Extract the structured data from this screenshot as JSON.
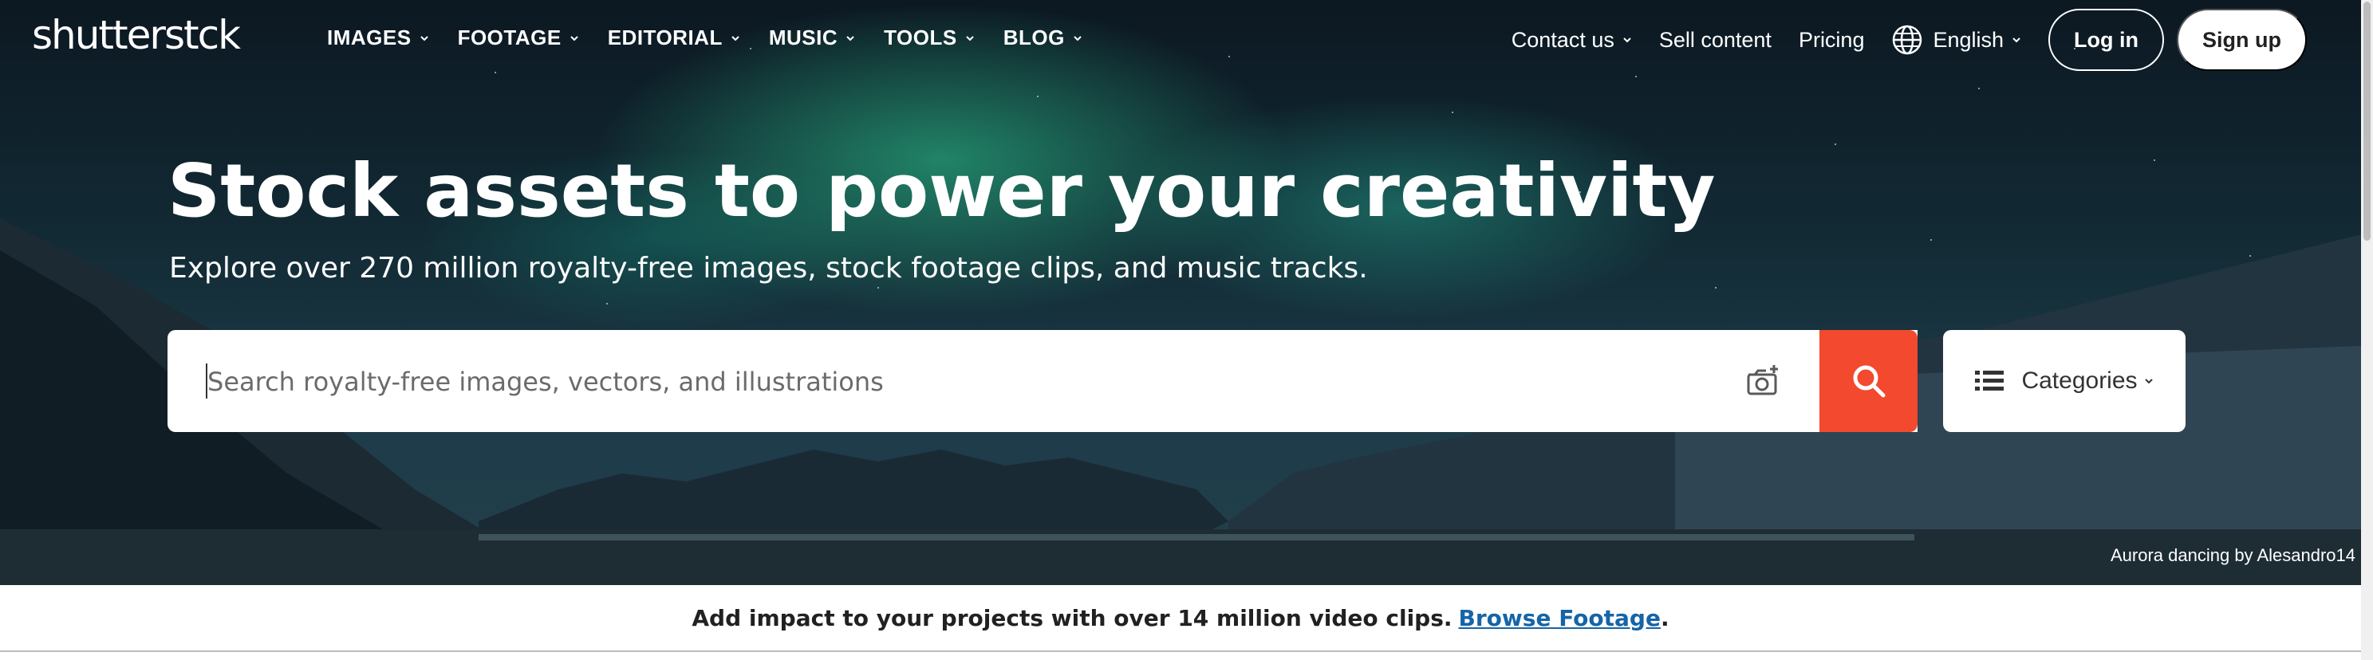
{
  "header": {
    "logo_text": "shutterstck",
    "nav": [
      {
        "label": "IMAGES"
      },
      {
        "label": "FOOTAGE"
      },
      {
        "label": "EDITORIAL"
      },
      {
        "label": "MUSIC"
      },
      {
        "label": "TOOLS"
      },
      {
        "label": "BLOG"
      }
    ],
    "contact_label": "Contact us",
    "sell_label": "Sell content",
    "pricing_label": "Pricing",
    "language_label": "English",
    "login_label": "Log in",
    "signup_label": "Sign up"
  },
  "hero": {
    "title": "Stock assets to power your creativity",
    "subtitle": "Explore over 270 million royalty-free images, stock footage clips, and music tracks.",
    "search_placeholder": "Search royalty-free images, vectors, and illustrations",
    "search_value": "",
    "categories_label": "Categories",
    "credit": "Aurora dancing by Alesandro14"
  },
  "promo": {
    "text": "Add impact to your projects with over 14 million video clips.",
    "link_label": "Browse Footage",
    "suffix": "."
  },
  "colors": {
    "search_button": "#f2492f",
    "link": "#1565a7"
  },
  "icons": [
    "globe-icon",
    "camera-plus-icon",
    "search-icon",
    "list-icon",
    "chevron-down-icon"
  ]
}
